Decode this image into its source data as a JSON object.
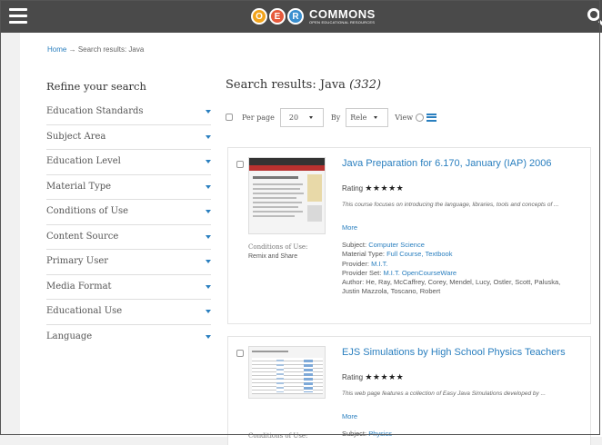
{
  "header": {
    "logo_letters": [
      "O",
      "E",
      "R"
    ],
    "logo_title": "COMMONS",
    "logo_subtitle": "OPEN EDUCATIONAL RESOURCES",
    "colors": {
      "bar": "#4a4a4a",
      "o": "#f2a31b",
      "e": "#e65a3c",
      "r": "#3a8fcf"
    },
    "icons": [
      "hamburger-menu-icon",
      "search-icon"
    ]
  },
  "breadcrumb": {
    "home": "Home",
    "separator": "→",
    "current": "Search results: Java"
  },
  "sidebar": {
    "title": "Refine your search",
    "filters": [
      "Education Standards",
      "Subject Area",
      "Education Level",
      "Material Type",
      "Conditions of Use",
      "Content Source",
      "Primary User",
      "Media Format",
      "Educational Use",
      "Language"
    ]
  },
  "results": {
    "title": "Search results: Java",
    "count": "(332)",
    "per_page_label": "Per page",
    "per_page_value": "20",
    "by_label": "By",
    "by_value": "Rele",
    "view_label": "View"
  },
  "items": [
    {
      "title": "Java Preparation for 6.170, January (IAP) 2006",
      "rating_label": "Rating",
      "stars": "★★★★★",
      "description": "This course focuses on introducing the language, libraries, tools and concepts of ...",
      "more": "More",
      "conditions_label": "Conditions of Use:",
      "conditions_value": "Remix and Share",
      "subject_label": "Subject:",
      "subject": "Computer Science",
      "material_type_label": "Material Type:",
      "material_type": "Full Course, Textbook",
      "provider_label": "Provider:",
      "provider": "M.I.T.",
      "provider_set_label": "Provider Set:",
      "provider_set": "M.I.T. OpenCourseWare",
      "author_label": "Author:",
      "author": "He, Ray, McCaffrey, Corey, Mendel, Lucy, Ostler, Scott, Paluska, Justin Mazzola, Toscano, Robert"
    },
    {
      "title": "EJS Simulations by High School Physics Teachers",
      "rating_label": "Rating",
      "stars": "★★★★★",
      "description": "This web page features a collection of Easy Java Simulations developed by ...",
      "more": "More",
      "conditions_label": "Conditions of Use:",
      "subject_label": "Subject:",
      "subject": "Physics"
    }
  ]
}
